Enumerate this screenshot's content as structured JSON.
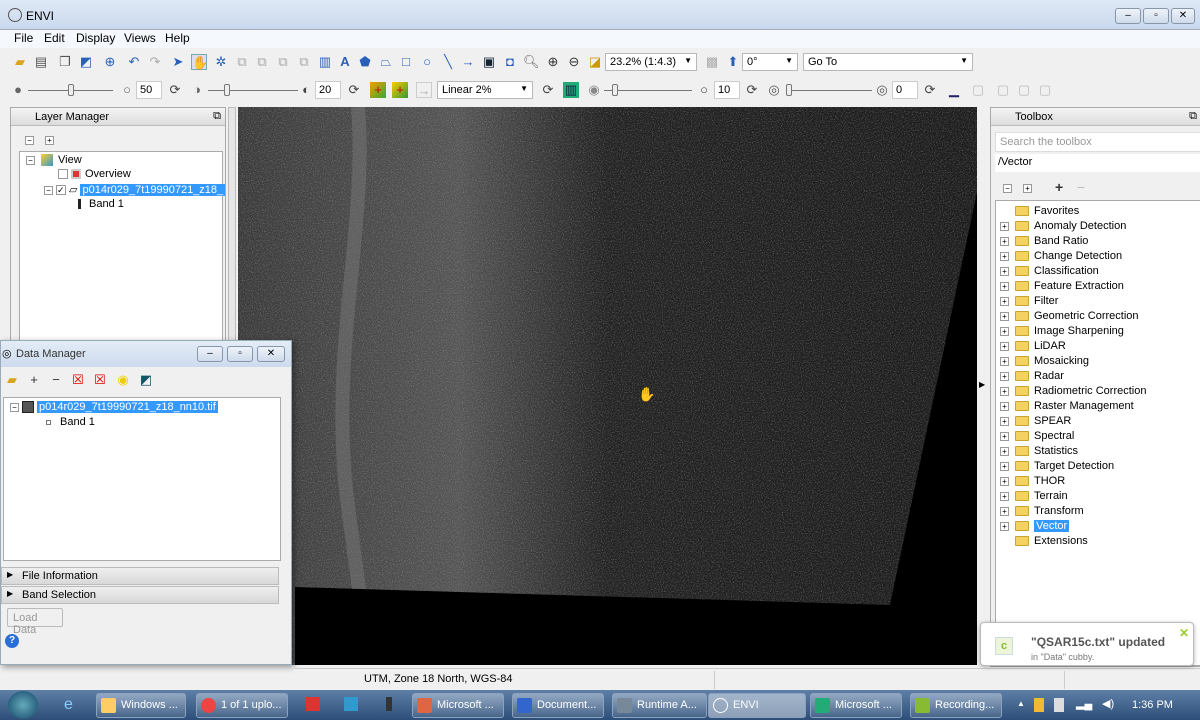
{
  "window": {
    "title": "ENVI"
  },
  "menu": [
    "File",
    "Edit",
    "Display",
    "Views",
    "Help"
  ],
  "toolbar": {
    "zoom": "23.2% (1:4.3)",
    "rotation": "0°",
    "goto": "Go To",
    "brightness": "50",
    "contrast": "20",
    "stretch": "Linear 2%",
    "sharpen": "10",
    "transparency": "0"
  },
  "layer_manager": {
    "title": "Layer Manager",
    "view": "View",
    "overview": "Overview",
    "layer": "p014r029_7t19990721_z18_",
    "band": "Band 1"
  },
  "data_manager": {
    "title": "Data Manager",
    "file": "p014r029_7t19990721_z18_nn10.tif",
    "band": "Band 1",
    "file_info": "File Information",
    "band_sel": "Band Selection",
    "load": "Load Data"
  },
  "toolbox": {
    "title": "Toolbox",
    "search_placeholder": "Search the toolbox",
    "path": "/Vector",
    "items": [
      "Favorites",
      "Anomaly Detection",
      "Band Ratio",
      "Change Detection",
      "Classification",
      "Feature Extraction",
      "Filter",
      "Geometric Correction",
      "Image Sharpening",
      "LiDAR",
      "Mosaicking",
      "Radar",
      "Radiometric Correction",
      "Raster Management",
      "SPEAR",
      "Spectral",
      "Statistics",
      "Target Detection",
      "THOR",
      "Terrain",
      "Transform",
      "Vector",
      "Extensions"
    ],
    "selected": "Vector"
  },
  "status": {
    "projection": "UTM, Zone 18 North, WGS-84"
  },
  "notification": {
    "title": "\"QSAR15c.txt\" updated",
    "body": "in \"Data\" cubby."
  },
  "taskbar": {
    "items": [
      "Windows ...",
      "1 of 1 uplo...",
      "Microsoft ...",
      "Document...",
      "Runtime A...",
      "ENVI",
      "Microsoft ...",
      "Recording..."
    ],
    "time": "1:36 PM"
  }
}
